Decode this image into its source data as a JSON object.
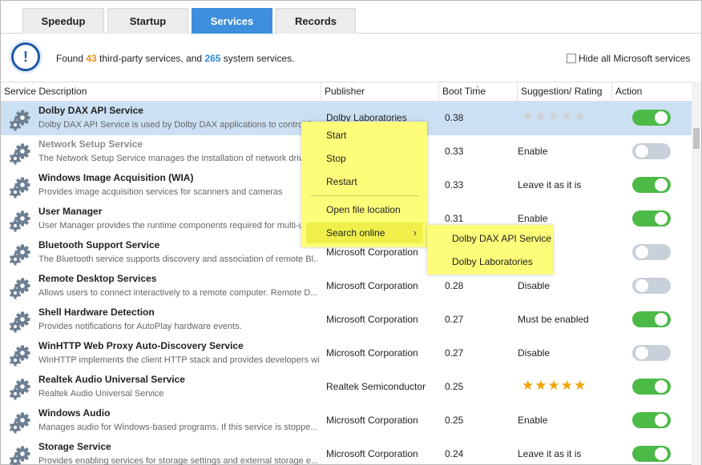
{
  "tabs": [
    {
      "label": "Speedup"
    },
    {
      "label": "Startup"
    },
    {
      "label": "Services"
    },
    {
      "label": "Records"
    }
  ],
  "active_tab": "Services",
  "info": {
    "prefix": "Found ",
    "third_party_count": "43",
    "middle": " third-party services, and ",
    "system_count": "265",
    "suffix": " system services.",
    "icon": "exclamation-icon",
    "hide_ms_label": "Hide all Microsoft services",
    "hide_ms_checked": false
  },
  "columns": {
    "service": "Service Description",
    "publisher": "Publisher",
    "boot_time": "Boot Time",
    "suggestion": "Suggestion/ Rating",
    "action": "Action"
  },
  "services": [
    {
      "name": "Dolby DAX API Service",
      "desc": "Dolby DAX API Service is used by Dolby DAX applications to control Dolby...",
      "publisher": "Dolby Laboratories",
      "boot": "0.38",
      "suggestion": "",
      "rating": 0,
      "enabled": true
    },
    {
      "name": "Network Setup Service",
      "desc": "The Network Setup Service manages the installation of network drivers...",
      "publisher": "",
      "boot": "0.33",
      "suggestion": "Enable",
      "rating": null,
      "enabled": false
    },
    {
      "name": "Windows Image Acquisition (WIA)",
      "desc": "Provides image acquisition services for scanners and cameras",
      "publisher": "",
      "boot": "0.33",
      "suggestion": "Leave it as it is",
      "rating": null,
      "enabled": true
    },
    {
      "name": "User Manager",
      "desc": "User Manager provides the runtime components required for multi-user...",
      "publisher": "",
      "boot": "0.31",
      "suggestion": "Enable",
      "rating": null,
      "enabled": true
    },
    {
      "name": "Bluetooth Support Service",
      "desc": "The Bluetooth service supports discovery and association of remote Bl...",
      "publisher": "Microsoft Corporation",
      "boot": "",
      "suggestion": "s it is",
      "rating": null,
      "enabled": false
    },
    {
      "name": "Remote Desktop Services",
      "desc": "Allows users to connect interactively to a remote computer. Remote D...",
      "publisher": "Microsoft Corporation",
      "boot": "0.28",
      "suggestion": "Disable",
      "rating": null,
      "enabled": false
    },
    {
      "name": "Shell Hardware Detection",
      "desc": "Provides notifications for AutoPlay hardware events.",
      "publisher": "Microsoft Corporation",
      "boot": "0.27",
      "suggestion": "Must be enabled",
      "rating": null,
      "enabled": true
    },
    {
      "name": "WinHTTP Web Proxy Auto-Discovery Service",
      "desc": "WinHTTP implements the client HTTP stack and provides developers wit...",
      "publisher": "Microsoft Corporation",
      "boot": "0.27",
      "suggestion": "Disable",
      "rating": null,
      "enabled": false
    },
    {
      "name": "Realtek Audio Universal Service",
      "desc": "Realtek Audio Universal Service",
      "publisher": "Realtek Semiconductor",
      "boot": "0.25",
      "suggestion": "",
      "rating": 5,
      "enabled": true
    },
    {
      "name": "Windows Audio",
      "desc": "Manages audio for Windows-based programs.  If this service is stoppe...",
      "publisher": "Microsoft Corporation",
      "boot": "0.25",
      "suggestion": "Enable",
      "rating": null,
      "enabled": true
    },
    {
      "name": "Storage Service",
      "desc": "Provides enabling services for storage settings and external storage e...",
      "publisher": "Microsoft Corporation",
      "boot": "0.24",
      "suggestion": "Leave it as it is",
      "rating": null,
      "enabled": true
    }
  ],
  "context_menu": {
    "start": "Start",
    "stop": "Stop",
    "restart": "Restart",
    "open_location": "Open file location",
    "search_online": "Search online"
  },
  "submenu": {
    "item1": "Dolby DAX API Service",
    "item2": "Dolby Laboratories"
  },
  "colors": {
    "accent": "#3d8fde",
    "toggle_on": "#4cba47",
    "toggle_off": "#c8d0d9",
    "menu_bg": "#fdfd7a",
    "third_party_count": "#e8901a",
    "system_count": "#2d8bd8",
    "star": "#f0a500"
  }
}
